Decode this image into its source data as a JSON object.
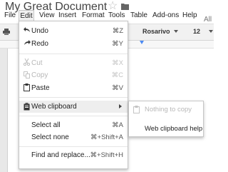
{
  "window": {
    "title": "My Great Document",
    "save_status": "All"
  },
  "menubar": {
    "items": [
      {
        "label": "File"
      },
      {
        "label": "Edit"
      },
      {
        "label": "View"
      },
      {
        "label": "Insert"
      },
      {
        "label": "Format"
      },
      {
        "label": "Tools"
      },
      {
        "label": "Table"
      },
      {
        "label": "Add-ons"
      },
      {
        "label": "Help"
      }
    ],
    "active": "Edit"
  },
  "toolbar": {
    "font": "Rosarivo",
    "font_size": "12"
  },
  "edit_menu": {
    "undo": {
      "label": "Undo",
      "shortcut": "⌘Z"
    },
    "redo": {
      "label": "Redo",
      "shortcut": "⌘Y"
    },
    "cut": {
      "label": "Cut",
      "shortcut": "⌘X",
      "disabled": true
    },
    "copy": {
      "label": "Copy",
      "shortcut": "⌘C",
      "disabled": true
    },
    "paste": {
      "label": "Paste",
      "shortcut": "⌘V"
    },
    "web_clipboard": {
      "label": "Web clipboard",
      "arrow": "►"
    },
    "select_all": {
      "label": "Select all",
      "shortcut": "⌘A"
    },
    "select_none": {
      "label": "Select none",
      "shortcut": "⌘+Shift+A"
    },
    "find_replace": {
      "label": "Find and replace...",
      "shortcut": "⌘+Shift+H"
    }
  },
  "web_clipboard_submenu": {
    "nothing": "Nothing to copy",
    "help": "Web clipboard help"
  },
  "colors": {
    "accent": "#4a8af4",
    "menu_hover": "#eeeeee",
    "disabled": "#b8b8b8"
  }
}
